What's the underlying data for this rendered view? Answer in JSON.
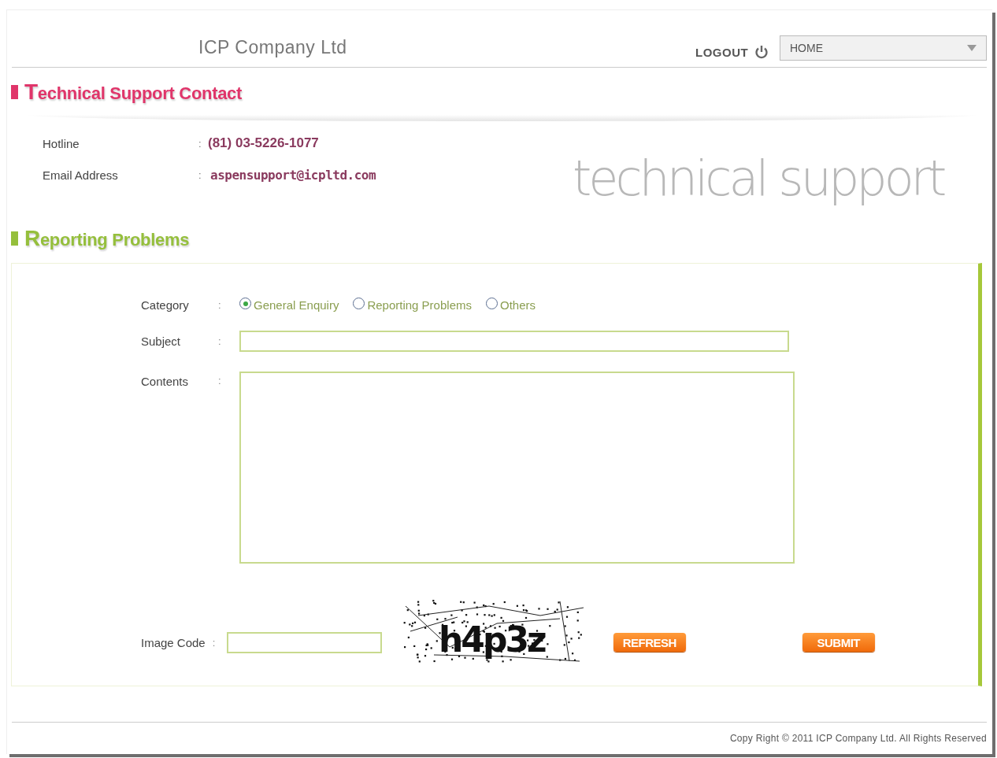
{
  "header": {
    "company": "ICP Company Ltd",
    "logout": "LOGOUT",
    "nav_select": {
      "value": "HOME"
    }
  },
  "contact": {
    "title": "Technical Support Contact",
    "rows": [
      {
        "label": "Hotline",
        "separator": ":",
        "value": "(81) 03-5226-1077",
        "kind": "phone"
      },
      {
        "label": "Email Address",
        "separator": ":",
        "value": "aspensupport@icpltd.com",
        "kind": "email"
      }
    ],
    "banner_text": "technical support"
  },
  "report": {
    "title": "Reporting Problems",
    "category": {
      "label": "Category",
      "separator": ":",
      "options": [
        {
          "label": "General Enquiry",
          "selected": true
        },
        {
          "label": "Reporting Problems",
          "selected": false
        },
        {
          "label": "Others",
          "selected": false
        }
      ]
    },
    "subject": {
      "label": "Subject",
      "separator": ":"
    },
    "contents": {
      "label": "Contents",
      "separator": ":"
    },
    "image_code": {
      "label": "Image Code",
      "separator": ":",
      "captcha": "h4p3z"
    },
    "buttons": [
      {
        "label": "REFRESH"
      },
      {
        "label": "SUBMIT"
      }
    ]
  },
  "footer": {
    "copyright": "Copy Right © 2011 ICP Company Ltd. All Rights Reserved"
  }
}
